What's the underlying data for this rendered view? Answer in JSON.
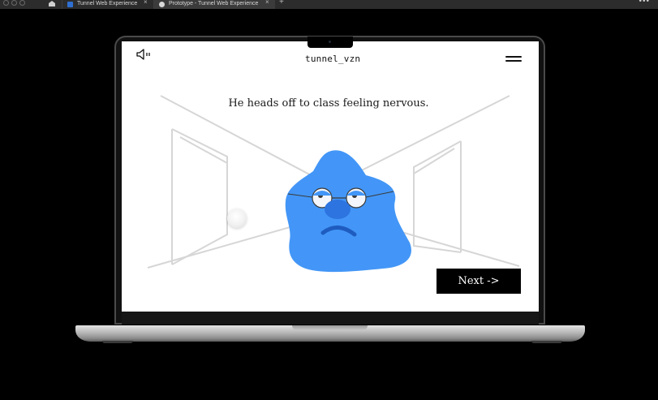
{
  "browser": {
    "tabs": [
      {
        "title": "Tunnel Web Experience",
        "active": false,
        "icon": "figma-file-icon"
      },
      {
        "title": "Prototype - Tunnel Web Experience",
        "active": true,
        "icon": "play-icon"
      }
    ],
    "new_tab_label": "+",
    "more_label": "•••",
    "close_label": "×"
  },
  "page": {
    "logo": "tunnel_vzn",
    "caption": "He heads off to class feeling nervous.",
    "next_label": "Next ->",
    "sound_icon": "speaker-icon",
    "menu_icon": "hamburger-menu-icon"
  },
  "colors": {
    "blob": "#4396F7",
    "blob_face": "#2d74e0",
    "tunnel_lines": "#d6d6d6",
    "screen_bg": "#ffffff",
    "button_bg": "#000000"
  }
}
